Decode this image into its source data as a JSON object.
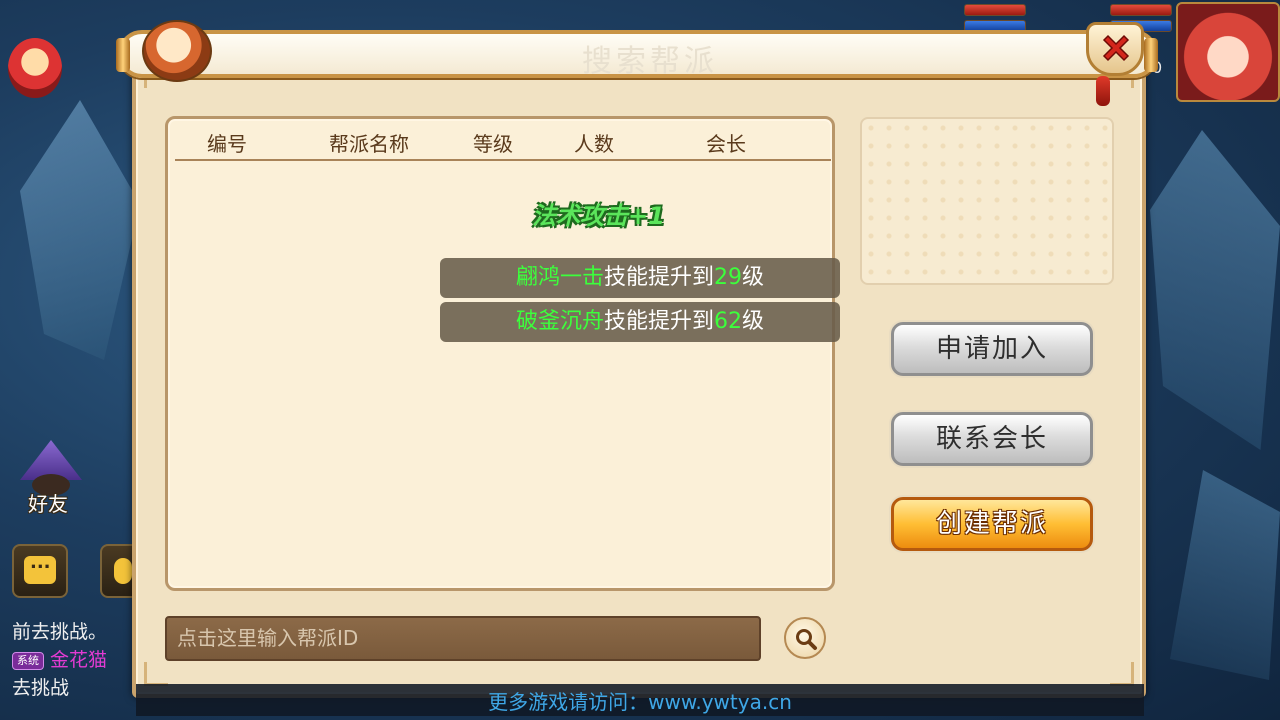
{
  "dialog": {
    "title": "搜索帮派",
    "close_icon": "close-x-icon"
  },
  "guild_list": {
    "columns": [
      "编号",
      "帮派名称",
      "等级",
      "人数",
      "会长"
    ],
    "rows": []
  },
  "notifications": {
    "buff": "法术攻击+1",
    "skill_1": {
      "skill": "翩鸿一击",
      "mid": "技能提升到",
      "level": "29",
      "suffix": "级"
    },
    "skill_2": {
      "skill": "破釜沉舟",
      "mid": "技能提升到",
      "level": "62",
      "suffix": "级"
    }
  },
  "actions": {
    "apply": "申请加入",
    "contact": "联系会长",
    "create": "创建帮派"
  },
  "search": {
    "placeholder": "点击这里输入帮派ID",
    "icon": "magnifier-icon"
  },
  "hud": {
    "friend_label": "好友",
    "side_number": "0",
    "chat_lines": [
      {
        "text": "前去挑战。"
      },
      {
        "tag": "系统",
        "name": "金花猫",
        "text": "去挑战"
      }
    ]
  },
  "footer": {
    "text": "更多游戏请访问：www.ywtya.cn"
  },
  "colors": {
    "highlight_green": "#3cff3c",
    "create_button": "#ffbe34",
    "footer_link": "#3fa7e6"
  }
}
